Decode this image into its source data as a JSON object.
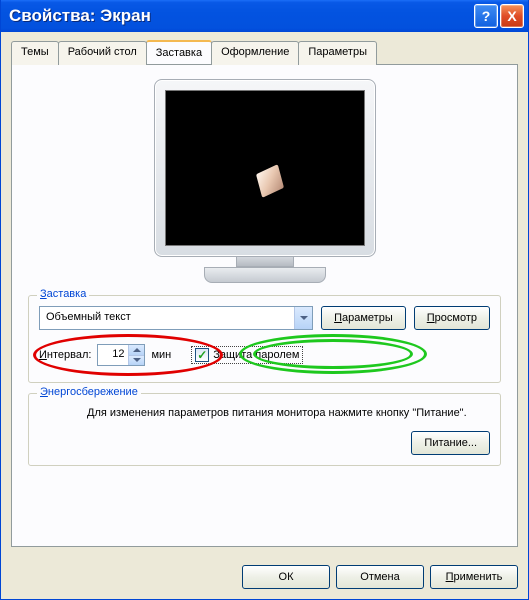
{
  "title": "Свойства: Экран",
  "tabs": {
    "themes": "Темы",
    "desktop": "Рабочий стол",
    "screensaver": "Заставка",
    "appearance": "Оформление",
    "settings": "Параметры"
  },
  "screensaver_group": {
    "legend_prefix": "З",
    "legend_rest": "аставка",
    "combo_value": "Объемный текст",
    "params_btn_prefix": "П",
    "params_btn_rest": "араметры",
    "preview_btn_prefix": "П",
    "preview_btn_rest": "росмотр",
    "interval_label_prefix": "И",
    "interval_label_rest": "нтервал:",
    "interval_value": "12",
    "interval_unit": "мин",
    "password_label": "Защита паролем"
  },
  "energy_group": {
    "legend_prefix": "Э",
    "legend_rest": "нергосбережение",
    "description": "Для изменения параметров питания монитора нажмите кнопку \"Питание\".",
    "power_btn": "Питание..."
  },
  "buttons": {
    "ok": "ОК",
    "cancel": "Отмена",
    "apply_prefix": "П",
    "apply_rest": "рименить"
  },
  "icons": {
    "help": "?",
    "close": "X",
    "check": "✓"
  },
  "colors": {
    "titlebar": "#0353e0",
    "accent_red": "#e00000",
    "accent_green": "#1ec81e"
  }
}
